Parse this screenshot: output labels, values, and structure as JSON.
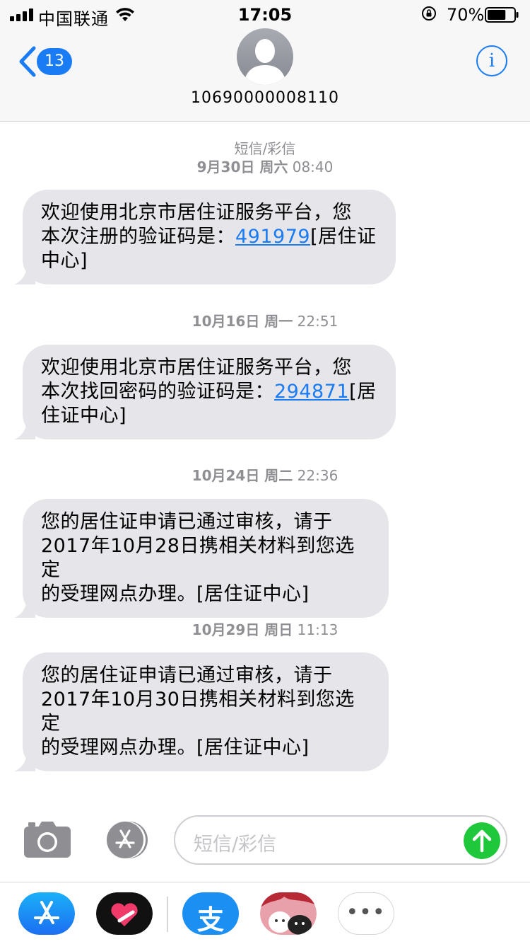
{
  "status_bar": {
    "carrier": "中国联通",
    "time": "17:05",
    "battery_percent": "70%",
    "battery_level": 0.7
  },
  "header": {
    "back_badge": "13",
    "contact": "10690000008110",
    "info_glyph": "i"
  },
  "conversation": {
    "type_label": "短信/彩信",
    "timestamps": [
      {
        "date": "9月30日 周六",
        "time": "08:40"
      },
      {
        "date": "10月16日 周一",
        "time": "22:51"
      },
      {
        "date": "10月24日 周二",
        "time": "22:36"
      },
      {
        "date": "10月29日 周日",
        "time": "11:13"
      }
    ],
    "messages": [
      {
        "line1": "欢迎使用北京市居住证服务平台，您",
        "pre": "本次注册的验证码是：",
        "code": "491979",
        "post": "[居住证",
        "line3": "中心]"
      },
      {
        "line1": "欢迎使用北京市居住证服务平台，您",
        "pre": "本次找回密码的验证码是：",
        "code": "294871",
        "post": "[居",
        "line3": "住证中心]"
      },
      {
        "line1": "您的居住证申请已通过审核，请于",
        "line2": "2017年10月28日携相关材料到您选定",
        "line3": "的受理网点办理。[居住证中心]"
      },
      {
        "line1": "您的居住证申请已通过审核，请于",
        "line2": "2017年10月30日携相关材料到您选定",
        "line3": "的受理网点办理。[居住证中心]"
      }
    ]
  },
  "composer": {
    "placeholder": "短信/彩信"
  },
  "app_strip": {
    "items": [
      "app-store-icon",
      "digital-touch-icon",
      "alipay-icon",
      "sticker-app-icon",
      "more-apps-icon"
    ],
    "alipay_glyph": "支",
    "more_glyph": "•••"
  },
  "colors": {
    "accent": "#1a7cf5",
    "bubble": "#e5e5ea",
    "send": "#1ec83a"
  }
}
